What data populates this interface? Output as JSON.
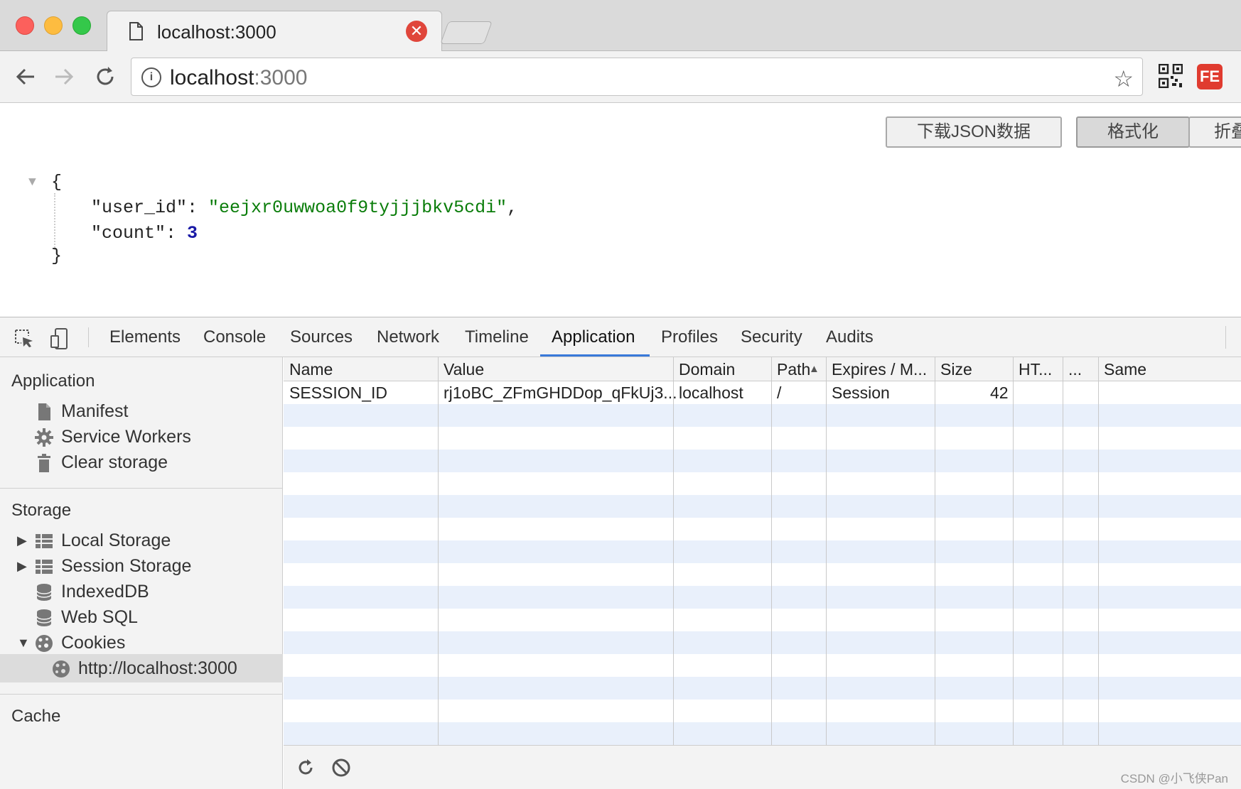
{
  "browser": {
    "tab_title": "localhost:3000",
    "url_host": "localhost",
    "url_port": ":3000"
  },
  "page": {
    "buttons": {
      "download": "下载JSON数据",
      "format": "格式化",
      "fold": "折叠"
    },
    "json": {
      "open": "{",
      "close": "}",
      "user_id_key": "\"user_id\"",
      "user_id_value": "\"eejxr0uwwoa0f9tyjjjbkv5cdi\"",
      "count_key": "\"count\"",
      "count_value": "3"
    }
  },
  "devtools": {
    "tabs": [
      "Elements",
      "Console",
      "Sources",
      "Network",
      "Timeline",
      "Application",
      "Profiles",
      "Security",
      "Audits"
    ],
    "active_tab": "Application",
    "sidebar": {
      "application_header": "Application",
      "application_items": [
        "Manifest",
        "Service Workers",
        "Clear storage"
      ],
      "storage_header": "Storage",
      "storage_items": [
        "Local Storage",
        "Session Storage",
        "IndexedDB",
        "Web SQL",
        "Cookies"
      ],
      "cookie_origin": "http://localhost:3000",
      "cache_header": "Cache"
    },
    "table": {
      "columns": [
        "Name",
        "Value",
        "Domain",
        "Path",
        "Expires / M...",
        "Size",
        "HT...",
        "...",
        "Same"
      ],
      "rows": [
        {
          "name": "SESSION_ID",
          "value": "rj1oBC_ZFmGHDDop_qFkUj3...",
          "domain": "localhost",
          "path": "/",
          "expires": "Session",
          "size": "42"
        }
      ]
    },
    "watermark": "CSDN @小飞侠Pan"
  },
  "colors": {
    "accent": "#3879d9",
    "json_string": "#0a7d0a",
    "json_number": "#1a1aa6",
    "row_alt": "#e9f0fb"
  }
}
